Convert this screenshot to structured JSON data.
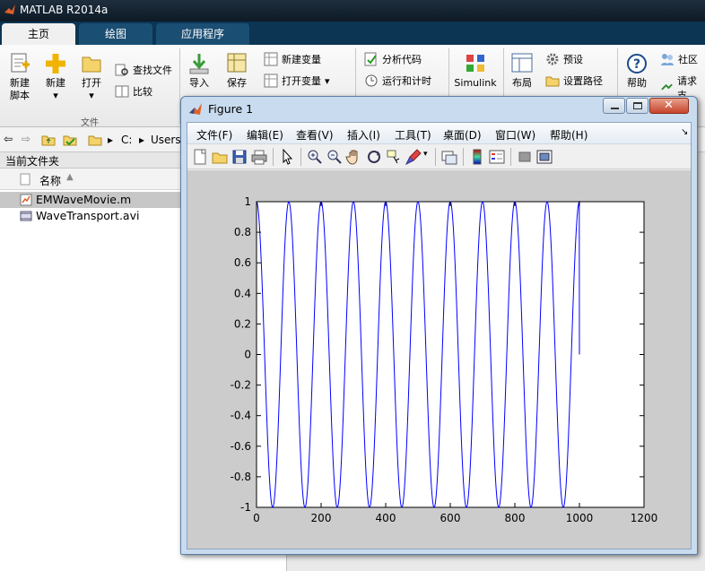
{
  "app": {
    "title": "MATLAB R2014a"
  },
  "ribbon_tabs": [
    "主页",
    "绘图",
    "应用程序"
  ],
  "ribbon": {
    "new_script": "新建\n脚本",
    "new_script_l1": "新建",
    "new_script_l2": "脚本",
    "new": "新建",
    "open": "打开",
    "find_files": "查找文件",
    "compare": "比较",
    "file_group": "文件",
    "import": "导入",
    "save": "保存",
    "new_variable": "新建变量",
    "open_variable": "打开变量",
    "analyze_code": "分析代码",
    "run_and_time": "运行和计时",
    "simulink": "Simulink",
    "layout": "布局",
    "preferences": "预设",
    "set_path": "设置路径",
    "help": "帮助",
    "community": "社区",
    "request_support": "请求支"
  },
  "path": {
    "drive": "C:",
    "users": "Users"
  },
  "current_folder": {
    "title": "当前文件夹",
    "column_name": "名称",
    "files": [
      {
        "name": "EMWaveMovie.m",
        "selected": true
      },
      {
        "name": "WaveTransport.avi",
        "selected": false
      }
    ]
  },
  "figure": {
    "title": "Figure 1",
    "menus": [
      "文件(F)",
      "编辑(E)",
      "查看(V)",
      "插入(I)",
      "工具(T)",
      "桌面(D)",
      "窗口(W)",
      "帮助(H)"
    ],
    "toolbar_icons": [
      "new-figure-icon",
      "open-file-icon",
      "save-icon",
      "print-icon",
      "edit-plot-arrow-icon",
      "zoom-in-icon",
      "zoom-out-icon",
      "pan-hand-icon",
      "rotate-3d-icon",
      "data-cursor-icon",
      "brush-icon",
      "link-plot-icon",
      "colorbar-icon",
      "legend-icon",
      "hide-plot-tools-icon",
      "show-plot-tools-icon"
    ]
  },
  "chart_data": {
    "type": "line",
    "title": "",
    "xlabel": "",
    "ylabel": "",
    "xlim": [
      0,
      1200
    ],
    "ylim": [
      -1,
      1
    ],
    "xticks": [
      0,
      200,
      400,
      600,
      800,
      1000,
      1200
    ],
    "yticks": [
      -1,
      -0.8,
      -0.6,
      -0.4,
      -0.2,
      0,
      0.2,
      0.4,
      0.6,
      0.8,
      1
    ],
    "ytick_labels": [
      "-1",
      "-0.8",
      "-0.6",
      "-0.4",
      "-0.2",
      "0",
      "0.2",
      "0.4",
      "0.6",
      "0.8",
      "1"
    ],
    "grid": false,
    "series": [
      {
        "color": "#0000ff",
        "description": "cosine wave y = cos(2*pi*x/100), x from 0 to 1000, period 100, ends at 0",
        "x_start": 0,
        "x_end": 1000,
        "period": 100,
        "end_value": 0
      }
    ]
  }
}
